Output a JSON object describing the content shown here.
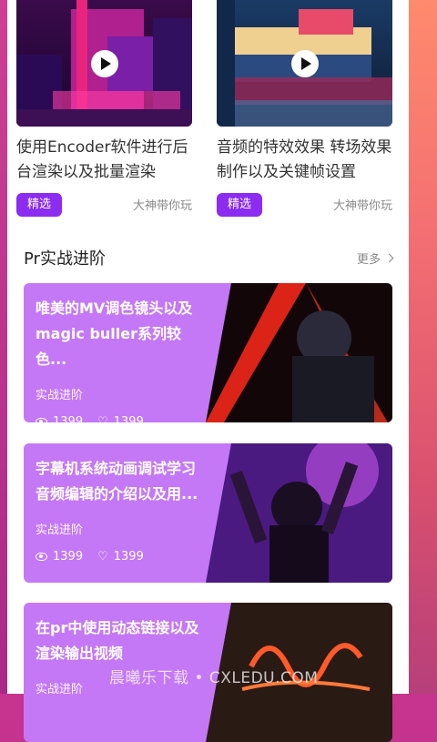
{
  "videos": [
    {
      "title": "使用Encoder软件进行后台渲染以及批量渲染",
      "badge": "精选",
      "author": "大神带你玩"
    },
    {
      "title": "音频的特效效果 转场效果制作以及关键帧设置",
      "badge": "精选",
      "author": "大神带你玩"
    }
  ],
  "section": {
    "title": "Pr实战进阶",
    "more": "更多"
  },
  "courses": [
    {
      "title": "唯美的MV调色镜头以及magic buller系列较色...",
      "tag": "实战进阶",
      "views": "1399",
      "likes": "1399"
    },
    {
      "title": "字幕机系统动画调试学习音频编辑的介绍以及用...",
      "tag": "实战进阶",
      "views": "1399",
      "likes": "1399"
    },
    {
      "title": "在pr中使用动态链接以及渲染输出视频",
      "tag": "实战进阶",
      "views": "",
      "likes": ""
    }
  ],
  "watermark": "晨曦乐下载 • CXLEDU.COM",
  "colors": {
    "accent": "#8b2cf0",
    "card": "#c478f5"
  }
}
